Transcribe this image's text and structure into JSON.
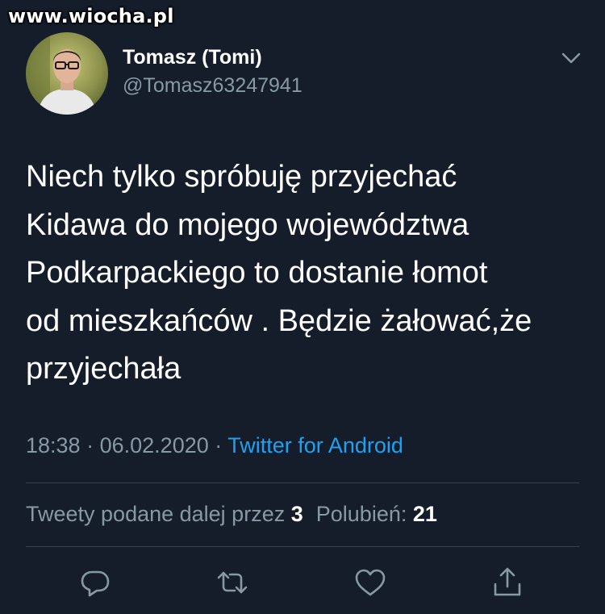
{
  "watermark": "www.wiocha.pl",
  "author": {
    "name": "Tomasz (Tomi)",
    "handle": "@Tomasz63247941"
  },
  "tweet": {
    "text": "Niech tylko spróbuję przyjechać\nKidawa do mojego województwa\nPodkarpackiego to dostanie łomot\nod mieszkańców . Będzie żałować,że\nprzyjechała",
    "time": "18:38",
    "separator": "·",
    "date": "06.02.2020",
    "source": "Twitter for Android"
  },
  "stats": {
    "retweets_label": "Tweety podane dalej przez",
    "retweets_count": "3",
    "likes_label": "Polubień:",
    "likes_count": "21"
  },
  "icons": {
    "more": "chevron-down-icon",
    "reply": "reply-icon",
    "retweet": "retweet-icon",
    "like": "heart-icon",
    "share": "share-icon"
  },
  "colors": {
    "background": "#151d2a",
    "text": "#ffffff",
    "muted": "#8899a6",
    "accent": "#1da1f2",
    "divider": "#38444d"
  }
}
